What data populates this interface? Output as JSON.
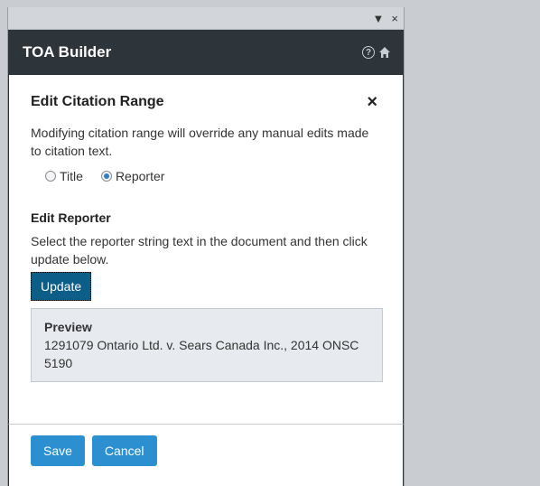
{
  "topbar": {
    "dropdown_glyph": "▼",
    "close_glyph": "×"
  },
  "header": {
    "title": "TOA Builder",
    "help_glyph": "?",
    "home_glyph": "⌂"
  },
  "section": {
    "title": "Edit Citation Range",
    "close_glyph": "×",
    "description": "Modifying citation range will override any manual edits made to citation text."
  },
  "radio": {
    "options": [
      {
        "label": "Title",
        "selected": false
      },
      {
        "label": "Reporter",
        "selected": true
      }
    ]
  },
  "edit": {
    "title": "Edit Reporter",
    "description": "Select the reporter string text in the document and then click update below.",
    "update_label": "Update"
  },
  "preview": {
    "title": "Preview",
    "text": "1291079 Ontario Ltd. v. Sears Canada Inc., 2014 ONSC 5190"
  },
  "footer": {
    "save_label": "Save",
    "cancel_label": "Cancel"
  },
  "colors": {
    "header_bg": "#2d353b",
    "button_primary": "#2b8fd0",
    "update_button": "#0d5d89",
    "preview_bg": "#e7ebf0"
  }
}
